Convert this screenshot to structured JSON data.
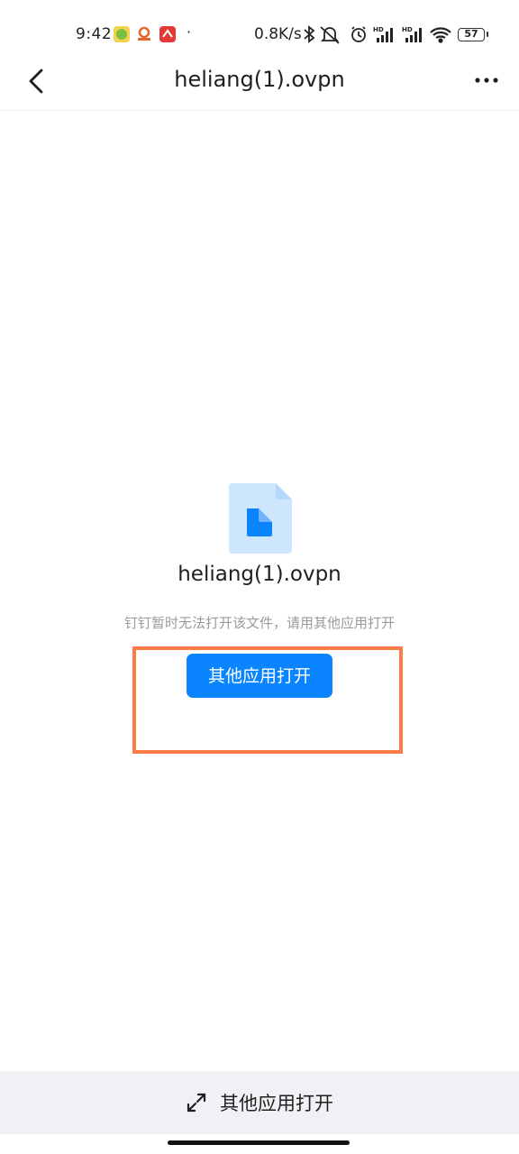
{
  "status_bar": {
    "time": "9:42",
    "dot": "·",
    "net_speed": "0.8K/s",
    "battery": "57",
    "icons": [
      "app-icon-green",
      "app-icon-orange",
      "app-icon-red",
      "bluetooth-icon",
      "mute-icon",
      "alarm-icon",
      "hd-signal-icon",
      "hd-signal-icon",
      "wifi-icon",
      "battery-icon"
    ]
  },
  "header": {
    "title": "heliang(1).ovpn"
  },
  "file": {
    "name": "heliang(1).ovpn",
    "hint": "钉钉暂时无法打开该文件，请用其他应用打开",
    "open_button": "其他应用打开"
  },
  "bottom_bar": {
    "label": "其他应用打开"
  },
  "colors": {
    "accent": "#0a84ff",
    "file_icon_bg": "#cfe6ff",
    "highlight": "#ff7b45",
    "bottom_bar_bg": "#f1f1f5"
  }
}
